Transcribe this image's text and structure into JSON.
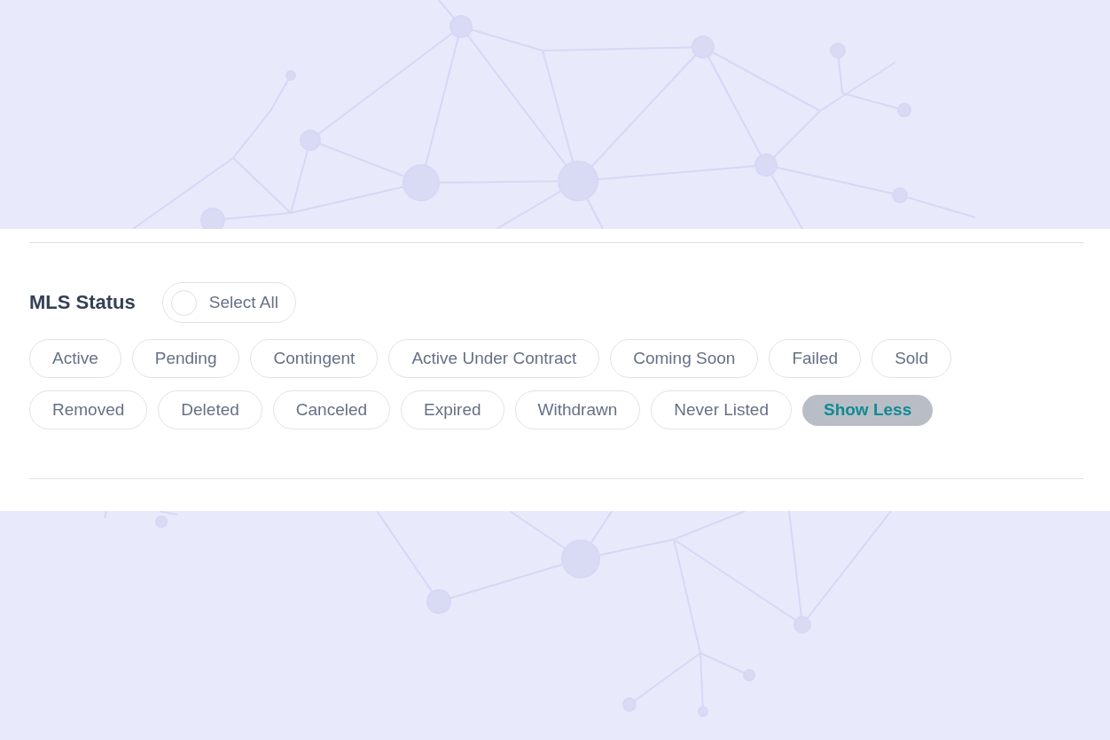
{
  "filter": {
    "title": "MLS Status",
    "select_all": {
      "label": "Select All",
      "checked": false
    },
    "chips": [
      {
        "label": "Active",
        "selected": false
      },
      {
        "label": "Pending",
        "selected": false
      },
      {
        "label": "Contingent",
        "selected": false
      },
      {
        "label": "Active Under Contract",
        "selected": false
      },
      {
        "label": "Coming Soon",
        "selected": false
      },
      {
        "label": "Failed",
        "selected": false
      },
      {
        "label": "Sold",
        "selected": false
      },
      {
        "label": "Removed",
        "selected": false
      },
      {
        "label": "Deleted",
        "selected": false
      },
      {
        "label": "Canceled",
        "selected": false
      },
      {
        "label": "Expired",
        "selected": false
      },
      {
        "label": "Withdrawn",
        "selected": false
      },
      {
        "label": "Never Listed",
        "selected": false
      }
    ],
    "toggle_button": {
      "label": "Show Less"
    }
  }
}
